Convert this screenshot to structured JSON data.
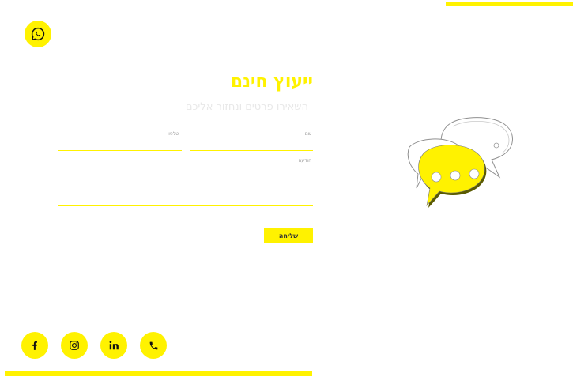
{
  "form": {
    "title": "ייעוץ חינם",
    "subtitle": "השאירו פרטים ונחזור אליכם",
    "name_label": "שם",
    "phone_label": "טלפון",
    "message_label": "הודעה",
    "submit_label": "שליחה"
  },
  "icons": {
    "contact": "whatsapp-icon",
    "social": [
      "facebook-icon",
      "instagram-icon",
      "linkedin-icon",
      "phone-icon"
    ],
    "illustration": "chat-bubbles-icon"
  },
  "colors": {
    "accent": "#fff200",
    "background": "#ffffff",
    "icon": "#111111"
  }
}
